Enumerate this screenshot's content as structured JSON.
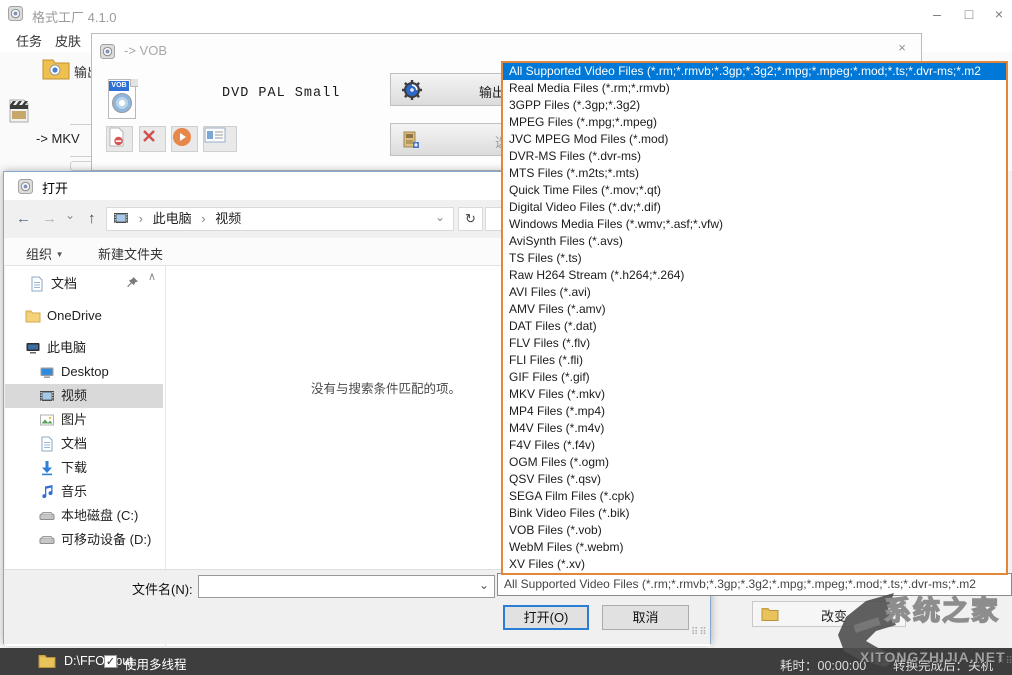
{
  "window": {
    "title": "格式工厂 4.1.0",
    "menu": {
      "tasks": "任务",
      "skins": "皮肤"
    },
    "controls": {
      "minimize": "–",
      "maximize": "□",
      "close": "×"
    }
  },
  "ff": {
    "output_folder_label": "输出文件",
    "tree_item_mkv": "-> MKV",
    "change_button": "改变",
    "statusbar": {
      "output_path": "D:\\FFOutput",
      "multithread": "使用多线程",
      "elapsed": "耗时：00:00:00",
      "after_task": "转换完成后：关机"
    }
  },
  "vob_dialog": {
    "title": "-> VOB",
    "close": "×",
    "badge": "VOB",
    "preset": "DVD PAL Small",
    "output_button": "输出",
    "options_button": "选"
  },
  "open_dialog": {
    "title": "打开",
    "breadcrumb": {
      "root": "此电脑",
      "current": "视频"
    },
    "organize": "组织",
    "new_folder": "新建文件夹",
    "empty_text": "没有与搜索条件匹配的项。",
    "filename_label": "文件名(N):",
    "filename_value": "",
    "open_button": "打开(O)",
    "cancel_button": "取消",
    "nav_items": [
      {
        "label": "文档",
        "icon": "document-icon",
        "quick": true,
        "pinned": true
      },
      {
        "label": "OneDrive",
        "icon": "onedrive-icon",
        "gap": true
      },
      {
        "label": "此电脑",
        "icon": "computer-icon",
        "gap": true
      },
      {
        "label": "Desktop",
        "icon": "desktop-icon",
        "child": true
      },
      {
        "label": "视频",
        "icon": "videos-icon",
        "child": true,
        "selected": true
      },
      {
        "label": "图片",
        "icon": "pictures-icon",
        "child": true
      },
      {
        "label": "文档",
        "icon": "documents-icon",
        "child": true
      },
      {
        "label": "下载",
        "icon": "downloads-icon",
        "child": true
      },
      {
        "label": "音乐",
        "icon": "music-icon",
        "child": true
      },
      {
        "label": "本地磁盘 (C:)",
        "icon": "drive-icon",
        "child": true
      },
      {
        "label": "可移动设备 (D:)",
        "icon": "drive-icon",
        "child": true
      }
    ]
  },
  "filetype": {
    "selected_index": 0,
    "selected": "All Supported Video Files (*.rm;*.rmvb;*.3gp;*.3g2;*.mpg;*.mpeg;*.mod;*.ts;*.dvr-ms;*.m2",
    "items": [
      "All Supported Video Files (*.rm;*.rmvb;*.3gp;*.3g2;*.mpg;*.mpeg;*.mod;*.ts;*.dvr-ms;*.m2",
      "Real Media Files (*.rm;*.rmvb)",
      "3GPP Files (*.3gp;*.3g2)",
      "MPEG Files (*.mpg;*.mpeg)",
      "JVC MPEG Mod Files (*.mod)",
      "DVR-MS Files (*.dvr-ms)",
      "MTS Files (*.m2ts;*.mts)",
      "Quick Time Files (*.mov;*.qt)",
      "Digital Video Files (*.dv;*.dif)",
      "Windows Media Files (*.wmv;*.asf;*.vfw)",
      "AviSynth Files (*.avs)",
      "TS Files (*.ts)",
      "Raw H264 Stream (*.h264;*.264)",
      "AVI Files (*.avi)",
      "AMV Files (*.amv)",
      "DAT Files (*.dat)",
      "FLV Files (*.flv)",
      "FLI Files (*.fli)",
      "GIF Files (*.gif)",
      "MKV Files (*.mkv)",
      "MP4 Files (*.mp4)",
      "M4V Files (*.m4v)",
      "F4V Files (*.f4v)",
      "OGM Files (*.ogm)",
      "QSV Files (*.qsv)",
      "SEGA Film Files (*.cpk)",
      "Bink Video Files (*.bik)",
      "VOB Files (*.vob)",
      "WebM Files (*.webm)",
      "XV Files (*.xv)"
    ]
  },
  "icons": {
    "back": "←",
    "forward": "→",
    "up": "↑",
    "chevron_down": "⌄",
    "refresh": "↻",
    "crumb_sep": "›",
    "menu_arrow": "▼",
    "scroll_up": "∧",
    "scroll_down": "∨",
    "check": "✓",
    "grip": "⠿⠿"
  },
  "watermark": {
    "name": "系统之家",
    "site": "XITONGZHIJIA.NET"
  },
  "colors": {
    "selection_blue": "#0078d7",
    "dropdown_border": "#e2873a",
    "statusbar_bg": "#3e3e3e",
    "folder_yellow": "#e8c25a"
  }
}
